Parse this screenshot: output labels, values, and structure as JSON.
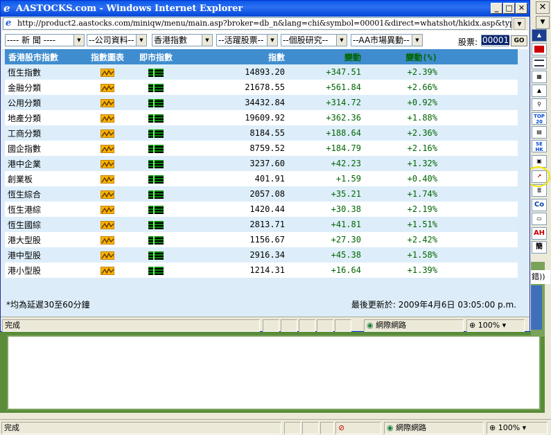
{
  "window": {
    "title": "AASTOCKS.com - Windows Internet Explorer",
    "address": "http://product2.aastocks.com/miniqw/menu/main.asp?broker=db_n&lang=chi&symbol=00001&direct=whatshot/hkidx.asp&typ=i"
  },
  "selects": [
    {
      "value": "---- 新 聞 ----"
    },
    {
      "value": "--公司資料--"
    },
    {
      "value": "香港指數"
    },
    {
      "value": "--活躍股票--"
    },
    {
      "value": "--個股研究--"
    },
    {
      "value": "--AA市場異動--"
    }
  ],
  "stock": {
    "label": "股票:",
    "value": "00001",
    "go_label": "GO"
  },
  "table": {
    "headers": [
      "香港股市指數",
      "指數圖表",
      "即市指數",
      "指數",
      "變動",
      "變動(%)"
    ],
    "rows": [
      {
        "name": "恆生指數",
        "index": "14893.20",
        "change": "+347.51",
        "pct": "+2.39%"
      },
      {
        "name": "金融分類",
        "index": "21678.55",
        "change": "+561.84",
        "pct": "+2.66%"
      },
      {
        "name": "公用分類",
        "index": "34432.84",
        "change": "+314.72",
        "pct": "+0.92%"
      },
      {
        "name": "地產分類",
        "index": "19609.92",
        "change": "+362.36",
        "pct": "+1.88%"
      },
      {
        "name": "工商分類",
        "index": "8184.55",
        "change": "+188.64",
        "pct": "+2.36%"
      },
      {
        "name": "國企指數",
        "index": "8759.52",
        "change": "+184.79",
        "pct": "+2.16%"
      },
      {
        "name": "港中企業",
        "index": "3237.60",
        "change": "+42.23",
        "pct": "+1.32%"
      },
      {
        "name": "創業板",
        "index": "401.91",
        "change": "+1.59",
        "pct": "+0.40%"
      },
      {
        "name": "恆生綜合",
        "index": "2057.08",
        "change": "+35.21",
        "pct": "+1.74%"
      },
      {
        "name": "恆生港綜",
        "index": "1420.44",
        "change": "+30.38",
        "pct": "+2.19%"
      },
      {
        "name": "恆生國綜",
        "index": "2813.71",
        "change": "+41.81",
        "pct": "+1.51%"
      },
      {
        "name": "港大型股",
        "index": "1156.67",
        "change": "+27.30",
        "pct": "+2.42%"
      },
      {
        "name": "港中型股",
        "index": "2916.34",
        "change": "+45.38",
        "pct": "+1.58%"
      },
      {
        "name": "港小型股",
        "index": "1214.31",
        "change": "+16.64",
        "pct": "+1.39%"
      }
    ]
  },
  "footer": {
    "note": "*均為延遲30至60分鐘",
    "updated": "最後更新於: 2009年4月6日  03:05:00 p.m."
  },
  "popup_status": {
    "text": "完成",
    "zone": "網際網路",
    "zoom": "100%"
  },
  "parent_status": {
    "text": "完成",
    "zone": "網際網路",
    "zoom": "100%"
  },
  "parent_side": {
    "partial_text": "錯))"
  },
  "toolbar_icons": [
    "aastocks-logo-icon",
    "flag-icon",
    "news-list-icon",
    "grid-icon",
    "chart-image-icon",
    "search-icon",
    "top20-icon",
    "quote-icon",
    "sehk-icon",
    "document-icon",
    "trend-chart-icon",
    "notes-icon",
    "co-icon",
    "folder-icon",
    "ah-icon",
    "simplified-icon"
  ],
  "toolbar_labels": {
    "top": "TOP 20",
    "sehk": "SE HK",
    "co": "Co",
    "ah": "AH",
    "simp": "簡"
  }
}
